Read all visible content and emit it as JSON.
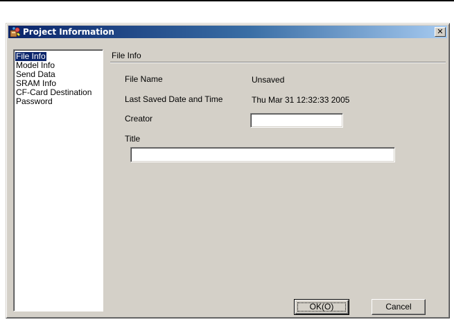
{
  "window": {
    "title": "Project Information",
    "close_glyph": "✕",
    "app_icon": "project-info-icon"
  },
  "sidebar": {
    "items": [
      {
        "label": "File Info",
        "selected": true
      },
      {
        "label": "Model Info",
        "selected": false
      },
      {
        "label": "Send Data",
        "selected": false
      },
      {
        "label": "SRAM Info",
        "selected": false
      },
      {
        "label": "CF-Card Destination",
        "selected": false
      },
      {
        "label": "Password",
        "selected": false
      }
    ]
  },
  "main": {
    "heading": "File Info",
    "file_name_label": "File Name",
    "file_name_value": "Unsaved",
    "last_saved_label": "Last Saved Date and Time",
    "last_saved_value": "Thu Mar 31 12:32:33 2005",
    "creator_label": "Creator",
    "creator_value": "",
    "title_label": "Title",
    "title_value": ""
  },
  "buttons": {
    "ok_label": "OK(O)",
    "cancel_label": "Cancel"
  },
  "colors": {
    "titlebar_start": "#0a246a",
    "titlebar_end": "#a6caf0",
    "dialog_face": "#d4d0c8",
    "selection": "#0a246a"
  }
}
